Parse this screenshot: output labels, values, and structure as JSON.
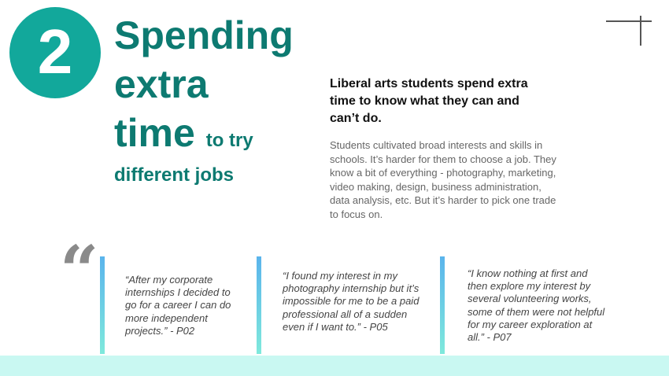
{
  "section": {
    "number": "2",
    "title_line1": "Spending",
    "title_line2": "extra",
    "title_line3_big": "time",
    "title_line3_small": "to try",
    "title_line4": "different jobs"
  },
  "subheading": "Liberal arts students spend extra time to know what they can and can’t do.",
  "body": "Students cultivated broad interests and skills in schools. It’s harder for them to choose a job. They know a bit of everything - photography, marketing, video making, design, business administration, data analysis, etc. But it’s harder to pick one trade to focus on.",
  "quote_mark": "“",
  "quotes": [
    {
      "text": "“After my corporate internships I decided to go for a career I can do more independent projects.” - P02"
    },
    {
      "text": "“I found my interest in my photography internship but it’s impossible for me to be a paid professional all of a sudden even if I want to.” - P05"
    },
    {
      "text": "“I know nothing at first and then explore my interest by several volunteering works, some of them were not helpful for my career exploration at all.” - P07"
    }
  ],
  "colors": {
    "accent": "#12a89b",
    "heading": "#0d7a71",
    "bar_top": "#5ab4ec",
    "bar_bottom": "#7fe9dc",
    "band": "#c9f8f2"
  }
}
